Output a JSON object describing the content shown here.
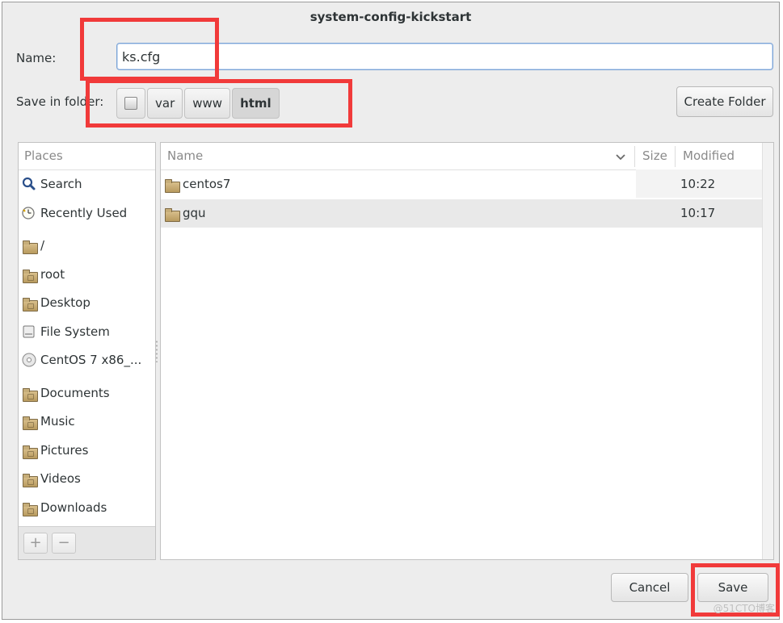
{
  "window": {
    "title": "system-config-kickstart"
  },
  "name_field": {
    "label": "Name:",
    "value": "ks.cfg"
  },
  "save_in": {
    "label": "Save in folder:",
    "breadcrumbs": [
      {
        "label": "",
        "icon": "drive-icon"
      },
      {
        "label": "var"
      },
      {
        "label": "www"
      },
      {
        "label": "html",
        "active": true
      }
    ]
  },
  "toolbar": {
    "create_folder": "Create Folder"
  },
  "places": {
    "header": "Places",
    "items": [
      {
        "label": "Search",
        "icon": "search-icon"
      },
      {
        "label": "Recently Used",
        "icon": "clock-icon"
      },
      {
        "label": "/",
        "icon": "folder-icon"
      },
      {
        "label": "root",
        "icon": "home-folder-icon"
      },
      {
        "label": "Desktop",
        "icon": "desktop-folder-icon"
      },
      {
        "label": "File System",
        "icon": "drive-icon"
      },
      {
        "label": "CentOS 7 x86_...",
        "icon": "disc-icon"
      },
      {
        "label": "Documents",
        "icon": "documents-folder-icon"
      },
      {
        "label": "Music",
        "icon": "music-folder-icon"
      },
      {
        "label": "Pictures",
        "icon": "pictures-folder-icon"
      },
      {
        "label": "Videos",
        "icon": "videos-folder-icon"
      },
      {
        "label": "Downloads",
        "icon": "downloads-folder-icon"
      }
    ],
    "add_label": "+",
    "remove_label": "−"
  },
  "file_list": {
    "columns": {
      "name": "Name",
      "size": "Size",
      "modified": "Modified"
    },
    "rows": [
      {
        "name": "centos7",
        "size": "",
        "modified": "10:22",
        "selected": false
      },
      {
        "name": "gqu",
        "size": "",
        "modified": "10:17",
        "selected": true
      }
    ]
  },
  "actions": {
    "cancel": "Cancel",
    "save": "Save"
  },
  "watermark": "@51CTO博客",
  "colors": {
    "highlight": "#f13a3a",
    "focus_border": "#7ba3d6"
  }
}
